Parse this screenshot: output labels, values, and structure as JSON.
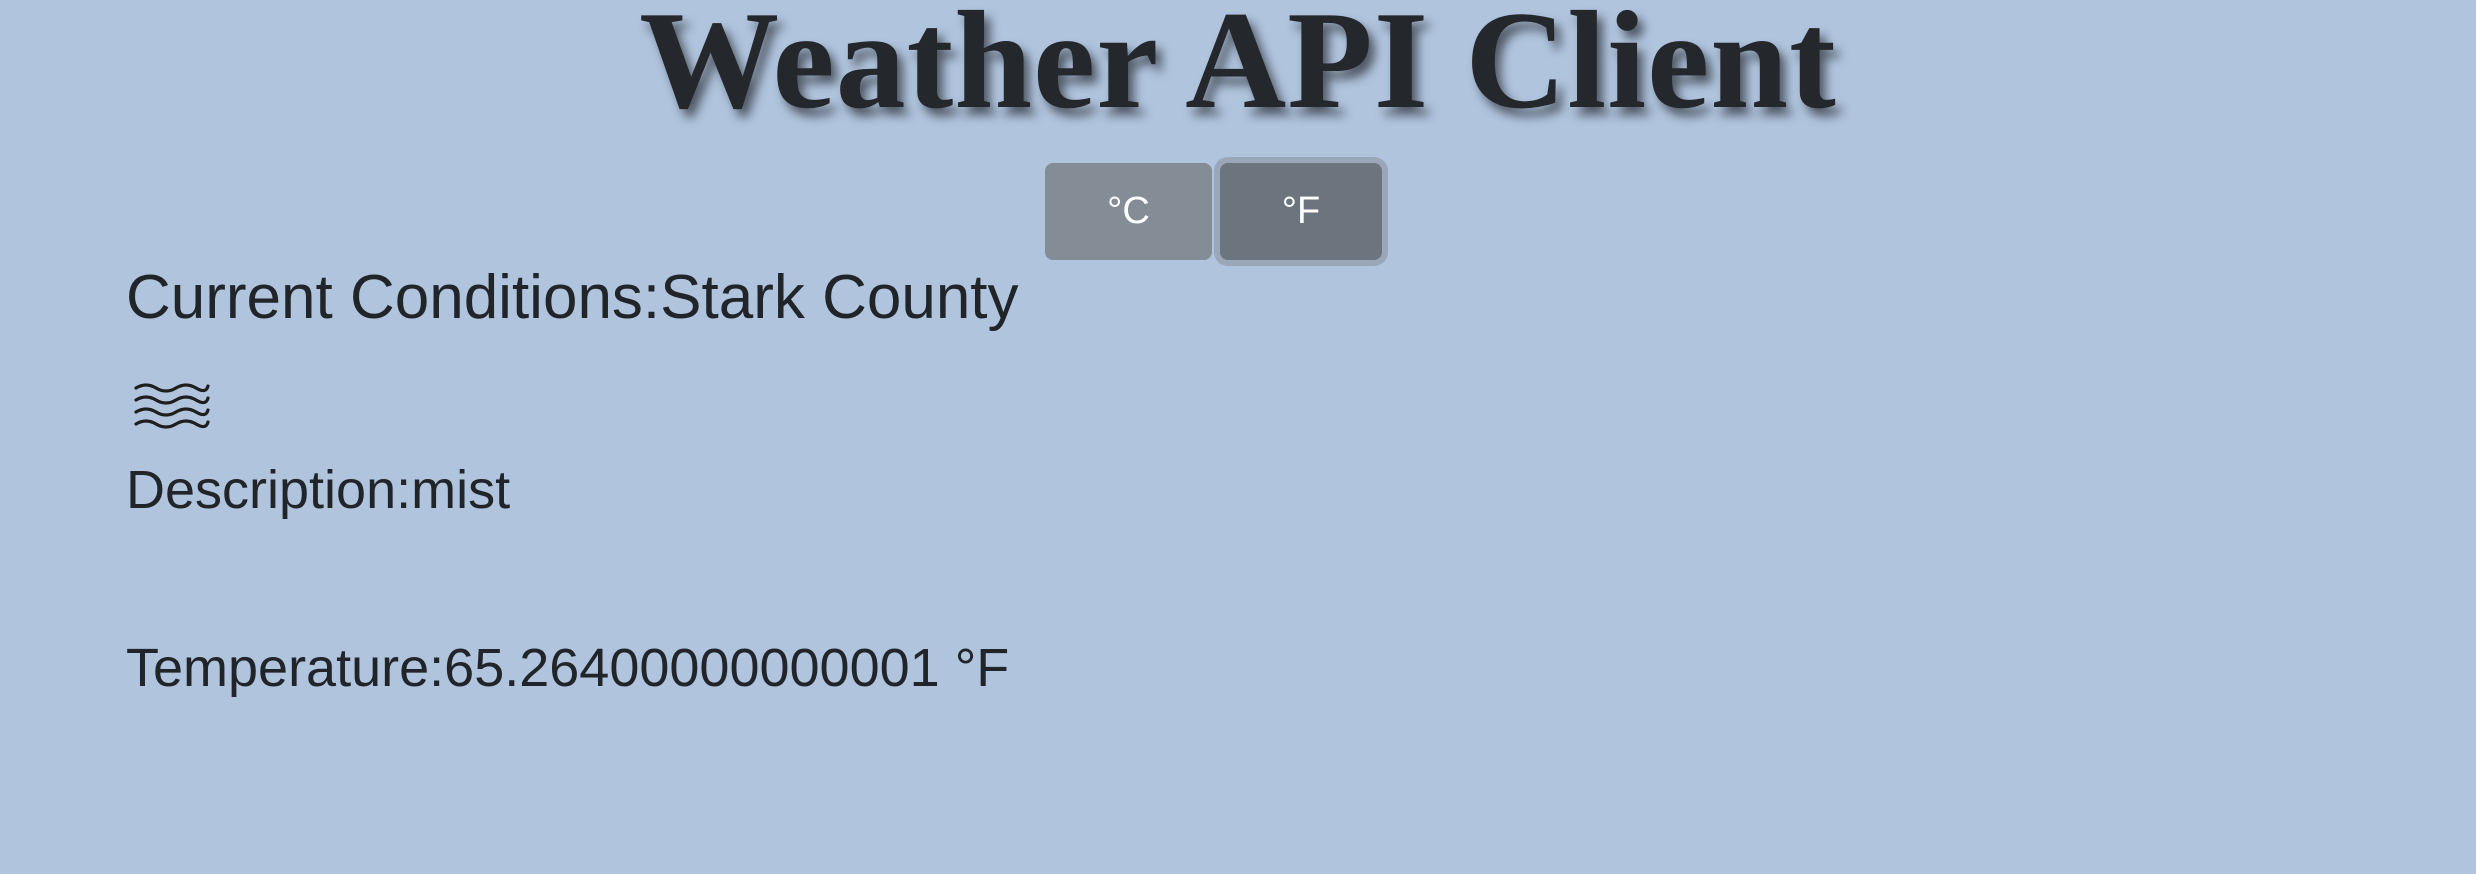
{
  "header": {
    "title": "Weather API Client"
  },
  "unit_toggle": {
    "celsius_label": "°C",
    "fahrenheit_label": "°F",
    "selected": "°F"
  },
  "current": {
    "heading_label": "Current Conditions:",
    "location": "Stark County",
    "icon": "mist-icon",
    "description_label": "Description:",
    "description": "mist",
    "temperature_label": "Temperature:",
    "temperature_value": "65.26400000000001",
    "temperature_unit": "°F"
  },
  "colors": {
    "background": "#b0c4de",
    "text": "#212529",
    "button_celsius": "#848c96",
    "button_fahrenheit": "#6c757d"
  }
}
